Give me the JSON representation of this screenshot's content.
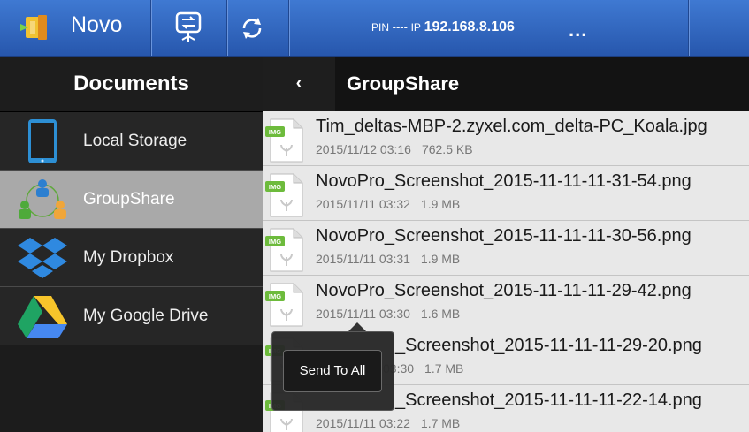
{
  "topbar": {
    "app_name": "Novo",
    "pin_label": "PIN",
    "pin_value": "----",
    "ip_label": "IP",
    "ip_value": "192.168.8.106",
    "more": "..."
  },
  "sidebar": {
    "title": "Documents",
    "items": [
      {
        "label": "Local Storage",
        "icon": "tablet-icon",
        "selected": false
      },
      {
        "label": "GroupShare",
        "icon": "group-share-icon",
        "selected": true
      },
      {
        "label": "My Dropbox",
        "icon": "dropbox-icon",
        "selected": false
      },
      {
        "label": "My Google Drive",
        "icon": "google-drive-icon",
        "selected": false
      }
    ]
  },
  "panel": {
    "back": "‹",
    "title": "GroupShare",
    "files": [
      {
        "name": "Tim_deltas-MBP-2.zyxel.com_delta-PC_Koala.jpg",
        "date": "2015/11/12 03:16",
        "size": "762.5 KB",
        "icon_badge": "IMG"
      },
      {
        "name": "NovoPro_Screenshot_2015-11-11-11-31-54.png",
        "date": "2015/11/11 03:32",
        "size": "1.9 MB",
        "icon_badge": "IMG"
      },
      {
        "name": "NovoPro_Screenshot_2015-11-11-11-30-56.png",
        "date": "2015/11/11 03:31",
        "size": "1.9 MB",
        "icon_badge": "IMG"
      },
      {
        "name": "NovoPro_Screenshot_2015-11-11-11-29-42.png",
        "date": "2015/11/11 03:30",
        "size": "1.6 MB",
        "icon_badge": "IMG"
      },
      {
        "name": "_Screenshot_2015-11-11-11-29-20.png",
        "date": "03:30",
        "size": "1.7 MB",
        "icon_badge": "IMG"
      },
      {
        "name": "_Screenshot_2015-11-11-11-22-14.png",
        "date": "2015/11/11 03:22",
        "size": "1.7 MB",
        "icon_badge": "IMG"
      }
    ]
  },
  "popup": {
    "send_to_all": "Send To All"
  },
  "colors": {
    "topbar": "#3466c0",
    "selected_item": "#a9a9a9",
    "file_badge": "#6dbb3c"
  }
}
